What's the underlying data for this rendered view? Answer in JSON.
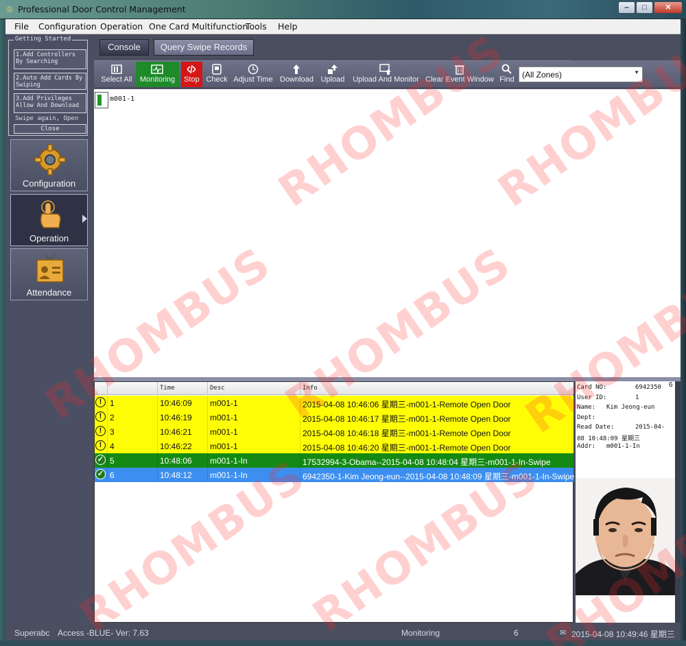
{
  "window": {
    "title": "Professional Door Control Management",
    "controls": {
      "minimize": "‒",
      "maximize": "□",
      "close": "✕"
    }
  },
  "menu": [
    "File",
    "Configuration",
    "Operation",
    "One Card Multifunction",
    "Tools",
    "Help"
  ],
  "getting_started": {
    "title": "Getting Started",
    "steps": [
      "1.Add Controllers By Searching",
      "2.Auto Add Cards By Swiping",
      "3.Add Privileges Allow And Download"
    ],
    "hint": "Swipe again, Open",
    "close_label": "Close"
  },
  "nav": [
    {
      "label": "Configuration",
      "icon": "gear-icon",
      "active": false
    },
    {
      "label": "Operation",
      "icon": "hand-pointer-icon",
      "active": true
    },
    {
      "label": "Attendance",
      "icon": "id-badge-icon",
      "active": false
    }
  ],
  "tabs": {
    "console": "Console",
    "query": "Query Swipe Records"
  },
  "toolbar": {
    "buttons": [
      {
        "label": "Select All",
        "icon": "select-all-icon"
      },
      {
        "label": "Monitoring",
        "icon": "monitor-icon"
      },
      {
        "label": "Stop",
        "icon": "stop-icon"
      },
      {
        "label": "Check",
        "icon": "check-shield-icon"
      },
      {
        "label": "Adjust Time",
        "icon": "clock-icon"
      },
      {
        "label": "Download",
        "icon": "arrow-up-icon"
      },
      {
        "label": "Upload",
        "icon": "upload-icon"
      },
      {
        "label": "Upload And Monitor",
        "icon": "upload-monitor-icon"
      },
      {
        "label": "Clear Event Window",
        "icon": "trash-icon"
      },
      {
        "label": "Find",
        "icon": "search-icon"
      }
    ],
    "zone": "(All Zones)"
  },
  "doors": [
    {
      "name": "m001-1",
      "status_color": "#1a9a2a"
    }
  ],
  "events": {
    "columns": [
      "",
      "",
      "Time",
      "Desc",
      "Info"
    ],
    "rows": [
      {
        "no": "1",
        "time": "10:46:09",
        "desc": "m001-1",
        "info": "2015-04-08 10:46:06 星期三-m001-1-Remote Open Door",
        "type": "warn"
      },
      {
        "no": "2",
        "time": "10:46:19",
        "desc": "m001-1",
        "info": "2015-04-08 10:46:17 星期三-m001-1-Remote Open Door",
        "type": "warn"
      },
      {
        "no": "3",
        "time": "10:46:21",
        "desc": "m001-1",
        "info": "2015-04-08 10:46:18 星期三-m001-1-Remote Open Door",
        "type": "warn"
      },
      {
        "no": "4",
        "time": "10:46:22",
        "desc": "m001-1",
        "info": "2015-04-08 10:46:20 星期三-m001-1-Remote Open Door",
        "type": "warn"
      },
      {
        "no": "5",
        "time": "10:48:06",
        "desc": "m001-1-In",
        "info": "17532994-3-Obama--2015-04-08 10:48:04 星期三-m001-1-In-Swipe",
        "type": "ok-green"
      },
      {
        "no": "6",
        "time": "10:48:12",
        "desc": "m001-1-In",
        "info": "6942350-1-Kim Jeong-eun--2015-04-08 10:48:09 星期三-m001-1-In-Swipe",
        "type": "ok-blue"
      }
    ]
  },
  "card": {
    "count": "6",
    "card_no_label": "Card NO:",
    "card_no": "6942350",
    "user_id_label": "User ID:",
    "user_id": "1",
    "name_label": "Name:",
    "name": "Kim Jeong-eun",
    "dept_label": "Dept:",
    "read_date_label": "Read Date:",
    "read_date_1": "2015-04-",
    "read_date_2": "08 10:48:09 星期三",
    "addr_label": "Addr:",
    "addr": "m001-1-In"
  },
  "status": {
    "user": "Superabc",
    "access": "Access -BLUE- Ver: 7.63",
    "mode": "Monitoring",
    "count": "6",
    "datetime": "2015-04-08 10:49:46 星期三"
  },
  "watermark": "RHOMBUS",
  "colors": {
    "warn_row": "#fffd06",
    "green_row": "#148a14",
    "blue_row": "#3c8ff0",
    "monitor_btn": "#1e8a2a",
    "stop_btn": "#d41616"
  }
}
